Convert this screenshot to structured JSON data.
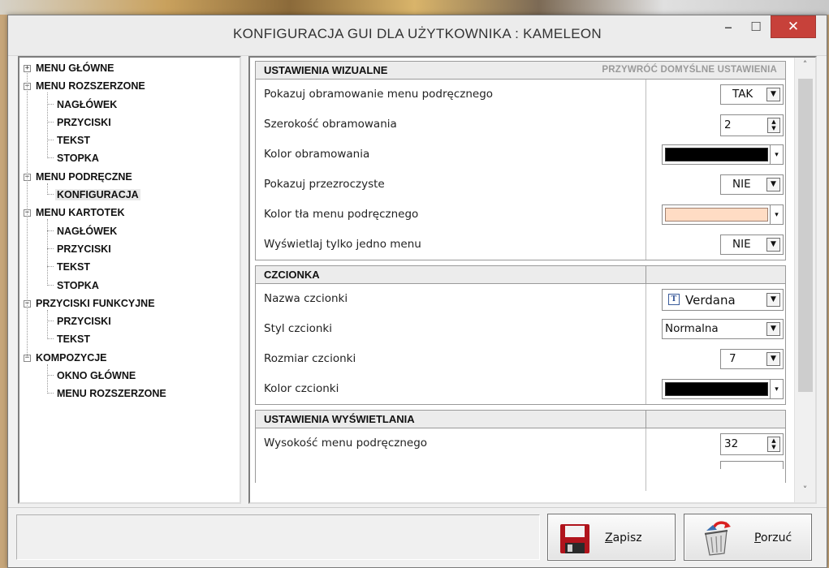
{
  "window": {
    "title": "KONFIGURACJA GUI DLA UŻYTKOWNIKA : KAMELEON",
    "minimize": "–",
    "maximize": "☐",
    "close": "✕"
  },
  "tree": {
    "items": [
      {
        "label": "MENU GŁÓWNE",
        "level": 0,
        "expander": "+"
      },
      {
        "label": "MENU ROZSZERZONE",
        "level": 0,
        "expander": "−"
      },
      {
        "label": "NAGŁÓWEK",
        "level": 1
      },
      {
        "label": "PRZYCISKI",
        "level": 1
      },
      {
        "label": "TEKST",
        "level": 1
      },
      {
        "label": "STOPKA",
        "level": 1
      },
      {
        "label": "MENU PODRĘCZNE",
        "level": 0,
        "expander": "−"
      },
      {
        "label": "KONFIGURACJA",
        "level": 1,
        "selected": true
      },
      {
        "label": "MENU KARTOTEK",
        "level": 0,
        "expander": "−"
      },
      {
        "label": "NAGŁÓWEK",
        "level": 1
      },
      {
        "label": "PRZYCISKI",
        "level": 1
      },
      {
        "label": "TEKST",
        "level": 1
      },
      {
        "label": "STOPKA",
        "level": 1
      },
      {
        "label": "PRZYCISKI FUNKCYJNE",
        "level": 0,
        "expander": "−"
      },
      {
        "label": "PRZYCISKI",
        "level": 1
      },
      {
        "label": "TEKST",
        "level": 1
      },
      {
        "label": "KOMPOZYCJE",
        "level": 0,
        "expander": "−"
      },
      {
        "label": "OKNO GŁÓWNE",
        "level": 1
      },
      {
        "label": "MENU ROZSZERZONE",
        "level": 1
      }
    ]
  },
  "visual": {
    "title": "USTAWIENIA WIZUALNE",
    "restore": "PRZYWRÓĆ DOMYŚLNE USTAWIENIA",
    "rows": {
      "border_show": {
        "label": "Pokazuj obramowanie menu podręcznego",
        "value": "TAK"
      },
      "border_width": {
        "label": "Szerokość obramowania",
        "value": "2"
      },
      "border_color": {
        "label": "Kolor obramowania",
        "color": "#000000"
      },
      "transparent": {
        "label": "Pokazuj przezroczyste",
        "value": "NIE"
      },
      "bg_color": {
        "label": "Kolor tła menu podręcznego",
        "color": "#ffdcc4"
      },
      "single_menu": {
        "label": "Wyświetlaj tylko jedno menu",
        "value": "NIE"
      }
    }
  },
  "font": {
    "title": "CZCIONKA",
    "rows": {
      "name": {
        "label": "Nazwa czcionki",
        "value": "Verdana",
        "icon": "truetype-font-icon"
      },
      "style": {
        "label": "Styl czcionki",
        "value": "Normalna"
      },
      "size": {
        "label": "Rozmiar czcionki",
        "value": "7"
      },
      "color": {
        "label": "Kolor czcionki",
        "color": "#000000"
      }
    }
  },
  "display": {
    "title": "USTAWIENIA WYŚWIETLANIA",
    "rows": {
      "height": {
        "label": "Wysokość menu podręcznego",
        "value": "32"
      }
    }
  },
  "buttons": {
    "save": "Zapisz",
    "cancel": "Porzuć"
  },
  "colors": {
    "close_button": "#c7413a",
    "save_icon": "#b0141c",
    "cancel_icon_arrow": "#d92020"
  }
}
